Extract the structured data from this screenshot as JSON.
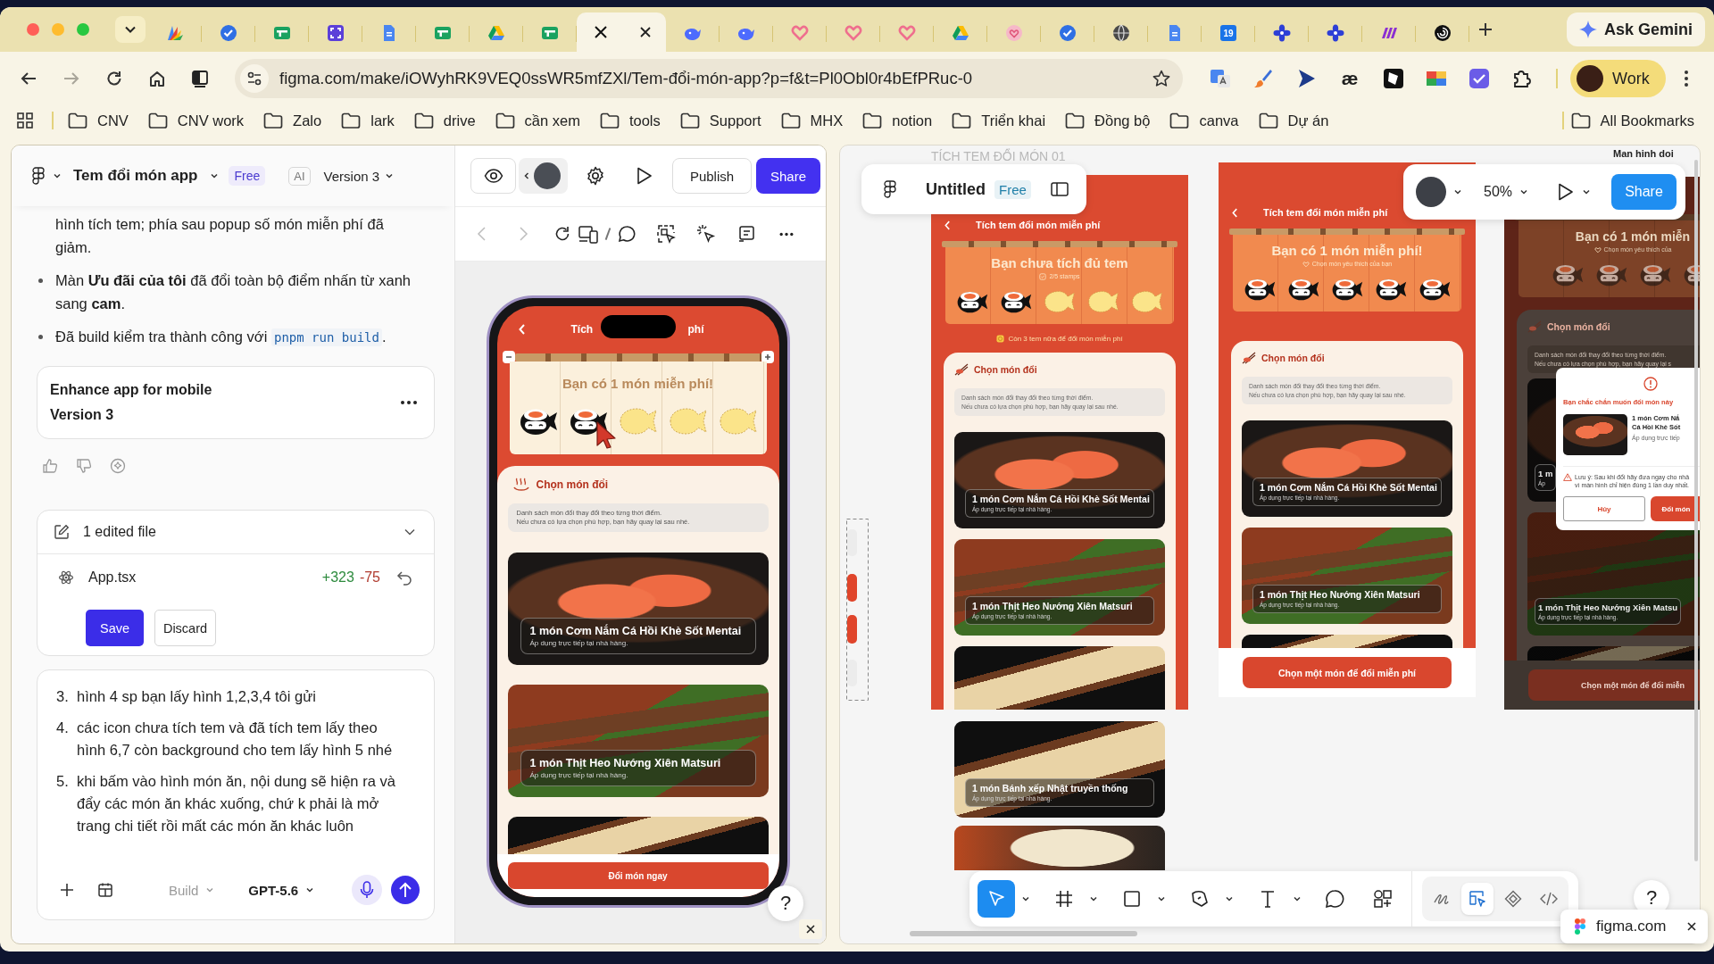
{
  "browser": {
    "tabs": [
      {
        "kind": "palette",
        "selected": false
      },
      {
        "kind": "check",
        "selected": false
      },
      {
        "kind": "sheet",
        "selected": false
      },
      {
        "kind": "expand",
        "selected": false
      },
      {
        "kind": "doc",
        "selected": false
      },
      {
        "kind": "sheet",
        "selected": false
      },
      {
        "kind": "drive",
        "selected": false
      },
      {
        "kind": "sheet",
        "selected": false
      },
      {
        "kind": "x",
        "selected": true
      },
      {
        "kind": "whale",
        "selected": false
      },
      {
        "kind": "whale",
        "selected": false
      },
      {
        "kind": "heart",
        "selected": false
      },
      {
        "kind": "heart",
        "selected": false
      },
      {
        "kind": "heart",
        "selected": false
      },
      {
        "kind": "drive",
        "selected": false
      },
      {
        "kind": "heart-badge",
        "selected": false
      },
      {
        "kind": "check",
        "selected": false
      },
      {
        "kind": "globe",
        "selected": false
      },
      {
        "kind": "doc",
        "selected": false
      },
      {
        "kind": "calendar",
        "selected": false,
        "label": "19"
      },
      {
        "kind": "flower",
        "selected": false
      },
      {
        "kind": "flower",
        "selected": false
      },
      {
        "kind": "stripes",
        "selected": false
      },
      {
        "kind": "ring",
        "selected": false
      }
    ],
    "ask": "Ask Gemini",
    "forward_disabled": true,
    "url": "figma.com/make/iOWyhRK9VEQ0ssWR5mfZXl/Tem-đổi-món-app?p=f&t=Pl0Obl0r4bEfPRuc-0",
    "extension_glyph": "æ",
    "profile": "Work",
    "bookmarks": [
      "CNV",
      "CNV work",
      "Zalo",
      "lark",
      "drive",
      "cần xem",
      "tools",
      "Support",
      "MHX",
      "notion",
      "Triển khai",
      "Đồng bộ",
      "canva",
      "Dự án"
    ],
    "all_bookmarks": "All Bookmarks"
  },
  "chat": {
    "project": "Tem đổi món app",
    "plan": "Free",
    "ai_badge": "AI",
    "version": "Version 3",
    "messages": [
      {
        "kind": "continuation",
        "text": "hình tích tem; phía sau popup số món miễn phí đã giảm."
      },
      {
        "kind": "bullet",
        "text": "Màn **Ưu đãi của tôi** đã đổi toàn bộ điểm nhấn từ xanh sang **cam**."
      },
      {
        "kind": "bullet",
        "text": "Đã build kiểm tra thành công với ",
        "code": "pnpm run build",
        "after": "."
      }
    ],
    "version_card": {
      "title": "Enhance app for mobile",
      "version": "Version 3"
    },
    "changes": {
      "title": "1 edited file",
      "expanded": true,
      "file": "App.tsx",
      "added": "+323",
      "removed": "-75",
      "save": "Save",
      "discard": "Discard"
    },
    "prompt": {
      "items": [
        {
          "number": "3.",
          "text": "hình 4 sp bạn lấy hình 1,2,3,4 tôi gửi"
        },
        {
          "number": "4.",
          "text": "các icon chưa tích tem và đã tích tem lấy theo hình 6,7 còn background cho tem lấy hình 5 nhé"
        },
        {
          "number": "5.",
          "text": "khi bấm vào hình món ăn, nội dung sẽ hiện ra và đẩy các món ăn khác xuống, chứ k phải là mở trang chi tiết rồi mất các món ăn khác luôn"
        }
      ],
      "mode": "Build",
      "mode_disabled": true,
      "model": "GPT-5.6"
    }
  },
  "preview": {
    "publish": "Publish",
    "share": "Share",
    "nav_disabled": true,
    "help": "?",
    "phone": {
      "title_start": "Tích",
      "title_end": "phí",
      "banner": "Bạn có 1 món miễn phí!",
      "stamps": [
        {
          "collected": true
        },
        {
          "collected": true
        },
        {
          "collected": false
        },
        {
          "collected": false
        },
        {
          "collected": false
        }
      ],
      "section": "Chọn món đổi",
      "note": "Danh sách món đổi thay đổi theo từng thời điểm.\nNếu chưa có lựa chọn phù hợp, bạn hãy quay lại sau nhé.",
      "cards": [
        {
          "kind": "salmon",
          "title": "1 món Cơm Nắm Cá Hồi Khè Sốt Mentai",
          "subtitle": "Áp dụng trực tiếp tại nhà hàng."
        },
        {
          "kind": "skewer",
          "title": "1 món Thịt Heo Nướng Xiên Matsuri",
          "subtitle": "Áp dụng trực tiếp tại nhà hàng."
        },
        {
          "kind": "dumpling"
        }
      ],
      "button": "Đổi món ngay"
    }
  },
  "canvas": {
    "file": "Untitled",
    "plan": "Free",
    "zoom": "50%",
    "share": "Share",
    "help": "?",
    "frames": [
      {
        "kind": "collecting",
        "label": "TÍCH TEM ĐỔI MÓN 01",
        "header": "Tích tem đổi món miễn phí",
        "title": "Bạn chưa tích đủ tem",
        "subtitle": "2/5 stamps",
        "stamps": [
          {
            "collected": true
          },
          {
            "collected": true
          },
          {
            "collected": false
          },
          {
            "collected": false
          },
          {
            "collected": false
          }
        ],
        "hint": "Còn 3 tem nữa để đổi món miễn phí",
        "section": "Chọn món đổi",
        "note": "Danh sách món đổi thay đổi theo từng thời điểm.\nNếu chưa có lựa chọn phù hợp, bạn hãy quay lại sau nhé.",
        "cards": [
          {
            "kind": "salmon",
            "title": "1 món Cơm Nắm Cá Hồi Khè Sốt Mentai",
            "subtitle": "Áp dụng trực tiếp tại nhà hàng."
          },
          {
            "kind": "skewer",
            "title": "1 món Thịt Heo Nướng Xiên Matsuri",
            "subtitle": "Áp dụng trực tiếp tại nhà hàng."
          },
          {
            "kind": "dumpling"
          }
        ]
      },
      {
        "kind": "ready",
        "header": "Tích tem đổi món miễn phí",
        "title": "Bạn có 1 món miễn phí!",
        "subtitle": "Chọn món yêu thích của bạn",
        "stamps": [
          {
            "collected": true
          },
          {
            "collected": true
          },
          {
            "collected": true
          },
          {
            "collected": true
          },
          {
            "collected": true
          }
        ],
        "section": "Chọn món đổi",
        "note": "Danh sách món đổi thay đổi theo từng thời điểm.\nNếu chưa có lựa chọn phù hợp, bạn hãy quay lại sau nhé.",
        "cards": [
          {
            "kind": "salmon",
            "title": "1 món Cơm Nắm Cá Hồi Khè Sốt Mentai",
            "subtitle": "Áp dụng trực tiếp tại nhà hàng."
          },
          {
            "kind": "skewer",
            "title": "1 món Thịt Heo Nướng Xiên Matsuri",
            "subtitle": "Áp dụng trực tiếp tại nhà hàng."
          },
          {
            "kind": "dumpling"
          }
        ],
        "button": "Chọn một món để đổi miễn phí"
      },
      {
        "kind": "confirm",
        "label": "Man hinh doi",
        "title": "Bạn có 1 món miễn",
        "subtitle": "Chọn món yêu thích của",
        "stamps": [
          {
            "collected": true
          },
          {
            "collected": true
          },
          {
            "collected": true
          },
          {
            "collected": true
          }
        ],
        "section": "Chọn món đổi",
        "note": "Danh sách món đổi thay đổi theo từng thời điểm.\nNếu chưa có lựa chọn phù hợp, bạn hãy quay lại s",
        "cards": [
          {
            "kind": "salmon",
            "title": "1 m",
            "subtitle": "Áp"
          },
          {
            "kind": "skewer",
            "title": "1 món Thịt Heo Nướng Xiên Matsu",
            "subtitle": "Áp dụng trực tiếp tại nhà hàng."
          },
          {
            "kind": "dumpling"
          }
        ],
        "button": "Chọn một món để đổi miễn",
        "dialog": {
          "title": "Bạn chắc chắn muốn đổi món này",
          "item_lines": [
            "1 món Cơm Nắ",
            "Cá Hồi Khè Sốt"
          ],
          "item_note": "Áp dụng trực tiếp",
          "warning": "Lưu ý: Sau khi đổi hãy đưa ngay cho nhâ\nvì màn hình chỉ hiện đúng 1 lần duy nhất.",
          "cancel": "Hủy",
          "confirm": "Đổi món"
        }
      }
    ],
    "loose_cards": [
      {
        "kind": "dumpling",
        "title": "1 món Bánh xếp Nhật truyền thống",
        "subtitle": "Áp dụng trực tiếp tại nhà hàng."
      },
      {
        "kind": "icecream"
      }
    ],
    "tools": [
      {
        "kind": "move",
        "selected": true
      },
      {
        "kind": "frame",
        "selected": false
      },
      {
        "kind": "shape",
        "selected": false
      },
      {
        "kind": "pen",
        "selected": false
      },
      {
        "kind": "text",
        "selected": false
      },
      {
        "kind": "comment",
        "selected": false
      },
      {
        "kind": "assets",
        "selected": false
      }
    ],
    "modes": [
      {
        "kind": "draw",
        "selected": false
      },
      {
        "kind": "design",
        "selected": true
      },
      {
        "kind": "component",
        "selected": false
      },
      {
        "kind": "code",
        "selected": false
      }
    ]
  },
  "popup": {
    "site": "figma.com"
  }
}
